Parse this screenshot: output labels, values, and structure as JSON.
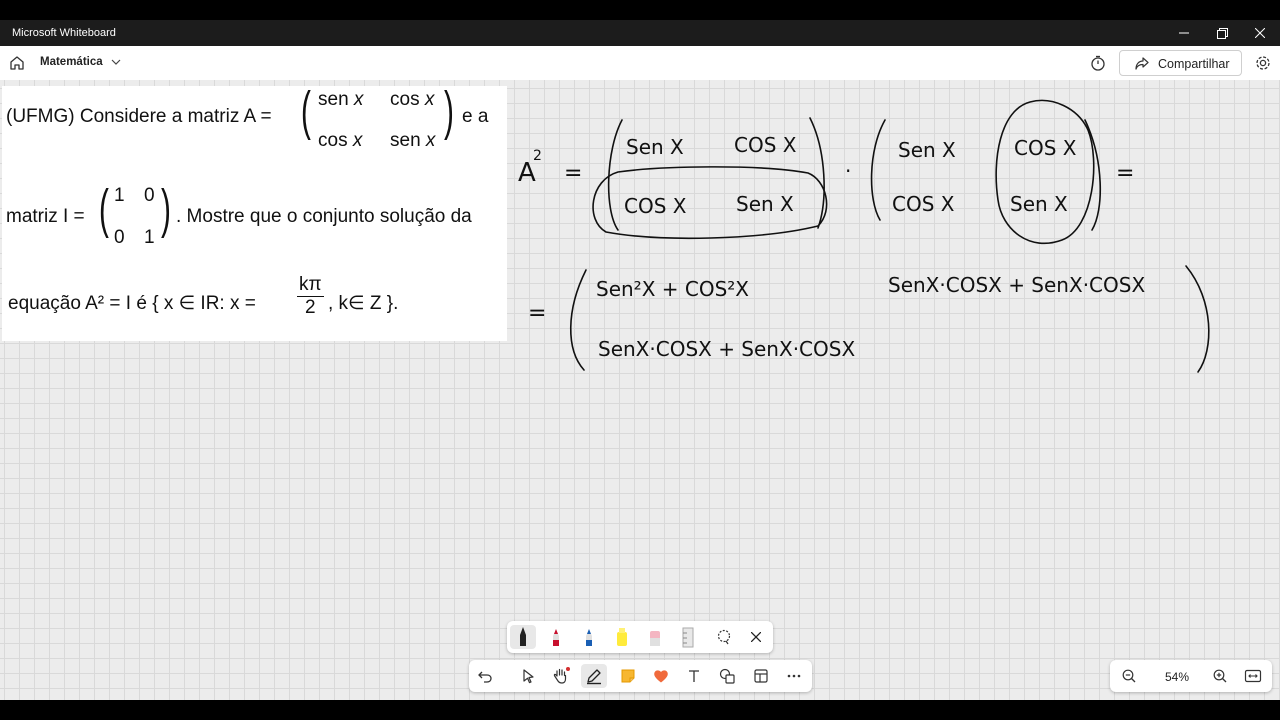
{
  "window": {
    "title": "Microsoft Whiteboard",
    "controls": [
      "minimize-icon",
      "restore-icon",
      "close-icon"
    ]
  },
  "appbar": {
    "board_name": "Matemática",
    "share_label": "Compartilhar",
    "icons": [
      "home-icon",
      "chevron-down-icon",
      "timer-icon",
      "share-icon",
      "gear-icon"
    ]
  },
  "problem": {
    "line1_prefix": "(UFMG) Considere a matriz A =",
    "line1_suffix": "e a",
    "matrix_a": [
      [
        "sen",
        "x",
        "cos",
        "x"
      ],
      [
        "cos",
        "x",
        "sen",
        "x"
      ]
    ],
    "line2_prefix": "matriz I =",
    "matrix_i": [
      [
        "1",
        "0"
      ],
      [
        "0",
        "1"
      ]
    ],
    "line2_suffix": ". Mostre que o conjunto solução da",
    "line3_prefix": "equação A² = I  é  { x ∈ IR: x =",
    "frac_num": "kπ",
    "frac_den": "2",
    "line3_suffix": ", k∈ Z }."
  },
  "handwriting": {
    "a_squared": "A",
    "exponent": "2",
    "equals": "=",
    "dot": "·",
    "m1": [
      "Sen X",
      "COS X",
      "COS X",
      "Sen X"
    ],
    "m2": [
      "Sen X",
      "COS X",
      "COS X",
      "Sen X"
    ],
    "r1c1": "Sen²X + COS²X",
    "r1c2": "SenX·COSX + SenX·COSX",
    "r2c1": "SenX·COSX + SenX·COSX"
  },
  "pen_toolbar": {
    "tools": [
      "black-pen-icon",
      "red-pen-icon",
      "blue-pen-icon",
      "yellow-highlighter-icon",
      "eraser-icon",
      "ruler-icon",
      "lasso-icon",
      "close-icon"
    ]
  },
  "main_toolbar": {
    "tools": [
      "undo-icon",
      "select-icon",
      "pan-hand-icon",
      "pen-icon",
      "sticky-note-icon",
      "reactions-icon",
      "text-icon",
      "shapes-icon",
      "templates-icon",
      "more-icon"
    ]
  },
  "zoom": {
    "level": "54%",
    "icons": [
      "zoom-out-icon",
      "zoom-in-icon",
      "fit-to-screen-icon"
    ]
  },
  "colors": {
    "titlebar": "#1c1c1c",
    "canvas": "#ececec",
    "grid": "#d9d9d9",
    "ink": "#111111"
  }
}
